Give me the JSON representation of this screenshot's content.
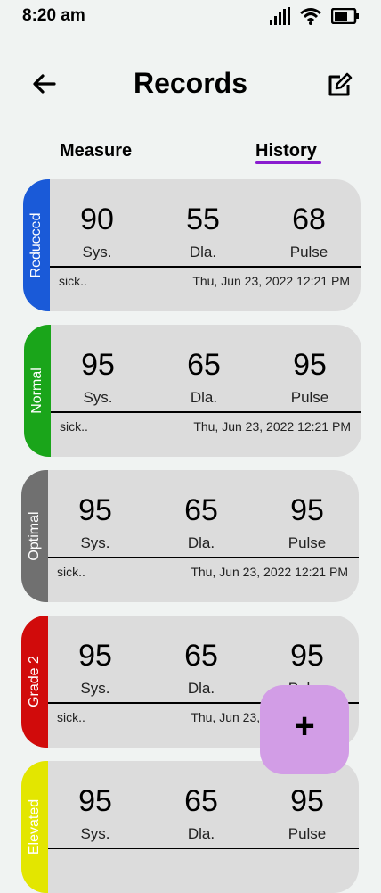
{
  "status_bar": {
    "time": "8:20 am"
  },
  "header": {
    "title": "Records"
  },
  "tabs": [
    {
      "label": "Measure"
    },
    {
      "label": "History"
    }
  ],
  "labels": {
    "sys": "Sys.",
    "dia": "Dla.",
    "pulse": "Pulse"
  },
  "records": [
    {
      "category": "Redueced",
      "color": "#1a5ad8",
      "sys": "90",
      "dia": "55",
      "pulse": "68",
      "note": "sick..",
      "date": "Thu, Jun 23, 2022  12:21 PM"
    },
    {
      "category": "Normal",
      "color": "#1aa51a",
      "sys": "95",
      "dia": "65",
      "pulse": "95",
      "note": "sick..",
      "date": "Thu, Jun 23, 2022  12:21 PM"
    },
    {
      "category": "Optimal",
      "color": "#707070",
      "sys": "95",
      "dia": "65",
      "pulse": "95",
      "note": "sick..",
      "date": "Thu, Jun 23, 2022  12:21 PM"
    },
    {
      "category": "Grade 2",
      "color": "#d10b0b",
      "sys": "95",
      "dia": "65",
      "pulse": "95",
      "note": "sick..",
      "date": "Thu, Jun 23, 2022  12:21 PM"
    },
    {
      "category": "Elevated",
      "color": "#e3e600",
      "sys": "95",
      "dia": "65",
      "pulse": "95",
      "note": "",
      "date": ""
    }
  ],
  "fab": {
    "label": "+",
    "color": "#d29de6"
  },
  "colors": {
    "tab_underline": "#8a1ccf",
    "card_bg": "#dcdcdc",
    "page_bg": "#f0f3f2"
  },
  "icons": [
    "back-arrow-icon",
    "edit-icon",
    "signal-icon",
    "wifi-icon",
    "battery-icon"
  ]
}
